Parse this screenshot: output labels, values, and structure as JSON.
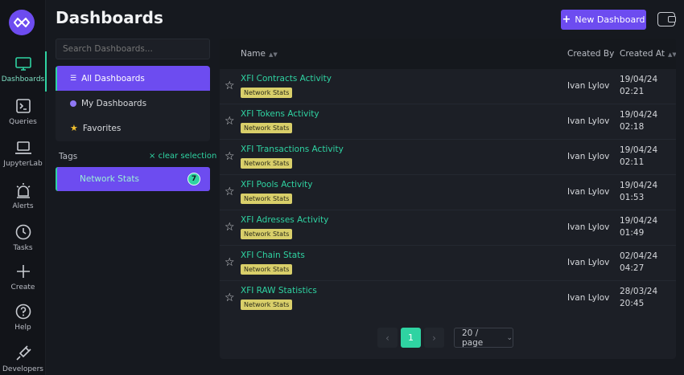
{
  "header": {
    "title": "Dashboards",
    "new_button": "New Dashboard"
  },
  "nav": [
    {
      "label": "Dashboards",
      "icon": "monitor-icon",
      "active": true
    },
    {
      "label": "Queries",
      "icon": "terminal-icon"
    },
    {
      "label": "JupyterLab",
      "icon": "laptop-icon"
    },
    {
      "label": "Alerts",
      "icon": "siren-icon"
    },
    {
      "label": "Tasks",
      "icon": "clock-icon"
    },
    {
      "label": "Create",
      "icon": "plus-icon"
    },
    {
      "label": "Help",
      "icon": "help-circle-icon"
    },
    {
      "label": "Developers",
      "icon": "plug-icon"
    }
  ],
  "search": {
    "placeholder": "Search Dashboards..."
  },
  "filters": {
    "all": "All Dashboards",
    "mine": "My Dashboards",
    "favorites": "Favorites"
  },
  "tags": {
    "label": "Tags",
    "clear": "clear selection",
    "items": [
      {
        "name": "Network Stats",
        "count": "7"
      }
    ]
  },
  "table": {
    "columns": {
      "name": "Name",
      "created_by": "Created By",
      "created_at": "Created At"
    },
    "rows": [
      {
        "title": "XFI Contracts Activity",
        "tag": "Network Stats",
        "author": "Ivan Lylov",
        "date": "19/04/24",
        "time": "02:21"
      },
      {
        "title": "XFI Tokens Activity",
        "tag": "Network Stats",
        "author": "Ivan Lylov",
        "date": "19/04/24",
        "time": "02:18"
      },
      {
        "title": "XFI Transactions Activity",
        "tag": "Network Stats",
        "author": "Ivan Lylov",
        "date": "19/04/24",
        "time": "02:11"
      },
      {
        "title": "XFI Pools Activity",
        "tag": "Network Stats",
        "author": "Ivan Lylov",
        "date": "19/04/24",
        "time": "01:53"
      },
      {
        "title": "XFI Adresses Activity",
        "tag": "Network Stats",
        "author": "Ivan Lylov",
        "date": "19/04/24",
        "time": "01:49"
      },
      {
        "title": "XFI Chain Stats",
        "tag": "Network Stats",
        "author": "Ivan Lylov",
        "date": "02/04/24",
        "time": "04:27"
      },
      {
        "title": "XFI RAW Statistics",
        "tag": "Network Stats",
        "author": "Ivan Lylov",
        "date": "28/03/24",
        "time": "20:45"
      }
    ]
  },
  "pagination": {
    "current": "1",
    "page_size": "20 / page"
  },
  "colors": {
    "accent": "#6d4cf0",
    "highlight": "#2fd3a2",
    "badge": "#d9cf6a",
    "background": "#16191f"
  }
}
